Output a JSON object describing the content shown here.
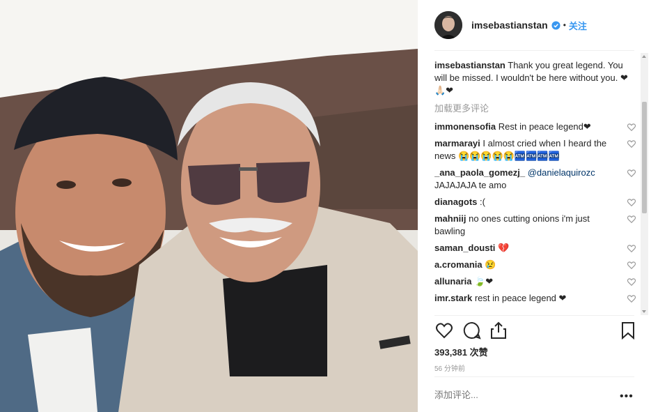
{
  "post": {
    "username": "imsebastianstan",
    "follow_label": "关注",
    "dot": "•",
    "caption_user": "imsebastianstan",
    "caption_text": "Thank you great legend. You will be missed. I wouldn't be here without you. ❤🙏🏻❤",
    "load_more": "加载更多评论",
    "comments": [
      {
        "user": "immonensofia",
        "text": "Rest in peace legend❤"
      },
      {
        "user": "marmarayi",
        "text": "I almost cried when I heard the news 😭😭😭😭😭🏧🏧🏧🏧"
      },
      {
        "user": "_ana_paola_gomezj_",
        "mention": "@danielaquirozc",
        "text": "JAJAJAJA te amo"
      },
      {
        "user": "dianagots",
        "text": ":("
      },
      {
        "user": "mahniij",
        "text": "no ones cutting onions i'm just bawling"
      },
      {
        "user": "saman_dousti",
        "text": "💔"
      },
      {
        "user": "a.cromania",
        "text": "😢"
      },
      {
        "user": "allunaria",
        "text": "🍃❤"
      },
      {
        "user": "imr.stark",
        "text": "rest in peace legend ❤"
      }
    ],
    "likes": "393,381 次赞",
    "time": "56 分钟前",
    "add_comment_placeholder": "添加评论...",
    "more_label": "•••"
  },
  "icons": {
    "like": "heart-icon",
    "comment": "comment-icon",
    "share": "share-icon",
    "save": "bookmark-icon",
    "verified": "verified-badge-icon"
  },
  "colors": {
    "link": "#3897f0",
    "mention": "#003569",
    "heart": "#ed4956",
    "muted": "#999999"
  }
}
